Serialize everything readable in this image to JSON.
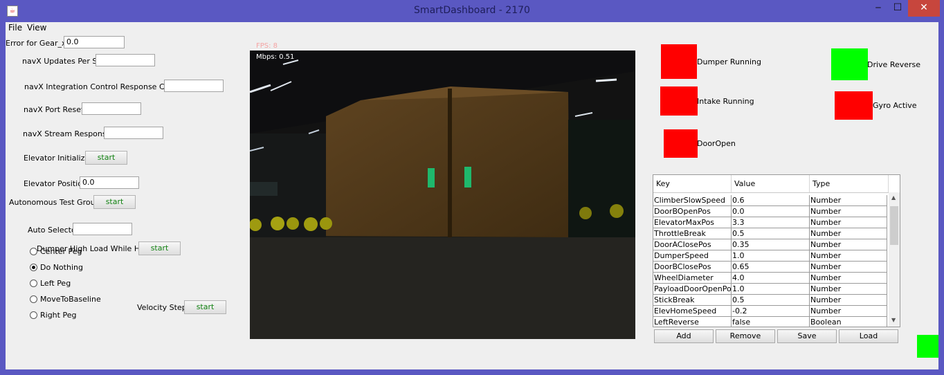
{
  "window": {
    "title": "SmartDashboard - 2170",
    "minimize": "‒",
    "maximize": "☐",
    "close": "✕",
    "app_icon": "java-icon"
  },
  "menu": [
    "File",
    "View"
  ],
  "widgets": {
    "gear_x": {
      "label": "Error for Gear_x:",
      "value": "0.0"
    },
    "navx_updates": {
      "label": "navX Updates Per Sec",
      "value": ""
    },
    "navx_integration": {
      "label": "navX Integration Control Response Count",
      "value": ""
    },
    "navx_port_resets": {
      "label": "navX Port Resets",
      "value": ""
    },
    "navx_stream": {
      "label": "navX Stream Responses",
      "value": ""
    },
    "elevator_init": {
      "label": "Elevator Initialize",
      "button": "start"
    },
    "elevator_pos": {
      "label": "Elevator Position",
      "value": "0.0"
    },
    "auto_test": {
      "label": "Autonomous Test Group",
      "button": "start"
    },
    "auto_selector": {
      "label": "Auto Selector",
      "value": ""
    },
    "dumper_high": {
      "label": "Dumper High Load While Held",
      "button": "start"
    },
    "velocity_step": {
      "label": "Velocity Step",
      "button": "start"
    },
    "radio_options": [
      "Center Peg",
      "Do Nothing",
      "Left Peg",
      "MoveToBaseline",
      "Right Peg"
    ],
    "radio_selected": "Do Nothing"
  },
  "camera": {
    "fps": "FPS: 8",
    "mbps": "Mbps: 0.51"
  },
  "indicators": {
    "dumper_running": {
      "label": "Dumper Running",
      "color": "#ff0000"
    },
    "intake_running": {
      "label": "Intake Running",
      "color": "#ff0000"
    },
    "door_open": {
      "label": "DoorOpen",
      "color": "#ff0000"
    },
    "drive_reverse": {
      "label": "Drive Reverse",
      "color": "#00ff00"
    },
    "gyro_active": {
      "label": "Gyro Active",
      "color": "#ff0000"
    },
    "corner": {
      "color": "#00ff00"
    }
  },
  "table": {
    "headers": [
      "Key",
      "Value",
      "Type"
    ],
    "rows": [
      [
        "ClimberSlowSpeed",
        "0.6",
        "Number"
      ],
      [
        "DoorBOpenPos",
        "0.0",
        "Number"
      ],
      [
        "ElevatorMaxPos",
        "3.3",
        "Number"
      ],
      [
        "ThrottleBreak",
        "0.5",
        "Number"
      ],
      [
        "DoorACIosePos",
        "0.35",
        "Number"
      ],
      [
        "DumperSpeed",
        "1.0",
        "Number"
      ],
      [
        "DoorBClosePos",
        "0.65",
        "Number"
      ],
      [
        "WheelDiameter",
        "4.0",
        "Number"
      ],
      [
        "PayloadDoorOpenPos",
        "1.0",
        "Number"
      ],
      [
        "StickBreak",
        "0.5",
        "Number"
      ],
      [
        "ElevHomeSpeed",
        "-0.2",
        "Number"
      ],
      [
        "LeftReverse",
        "false",
        "Boolean"
      ]
    ],
    "buttons": [
      "Add",
      "Remove",
      "Save",
      "Load"
    ]
  }
}
